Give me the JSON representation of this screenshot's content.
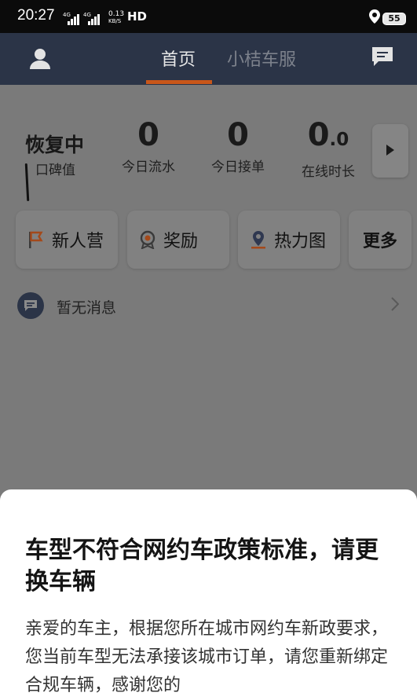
{
  "status_bar": {
    "time": "20:27",
    "network_1": "4G",
    "network_2": "4G",
    "speed_value": "0.13",
    "speed_unit": "KB/S",
    "hd": "HD",
    "battery": "55"
  },
  "nav": {
    "tab_home": "首页",
    "tab_service": "小桔车服",
    "active_color": "#c8561a"
  },
  "stats": {
    "status_label": "恢复中",
    "reputation_label": "口碑值",
    "flow_value": "0",
    "flow_label": "今日流水",
    "orders_value": "0",
    "orders_label": "今日接单",
    "online_value": "0",
    "online_value_decimal": ".0",
    "online_label": "在线时长"
  },
  "tiles": {
    "newbie": "新人营",
    "reward": "奖励",
    "heatmap": "热力图",
    "more": "更多"
  },
  "message": {
    "text": "暂无消息"
  },
  "sheet": {
    "title": "车型不符合网约车政策标准，请更换车辆",
    "body": "亲爱的车主，根据您所在城市网约车新政要求，您当前车型无法承接该城市订单，请您重新绑定合规车辆，感谢您的"
  }
}
